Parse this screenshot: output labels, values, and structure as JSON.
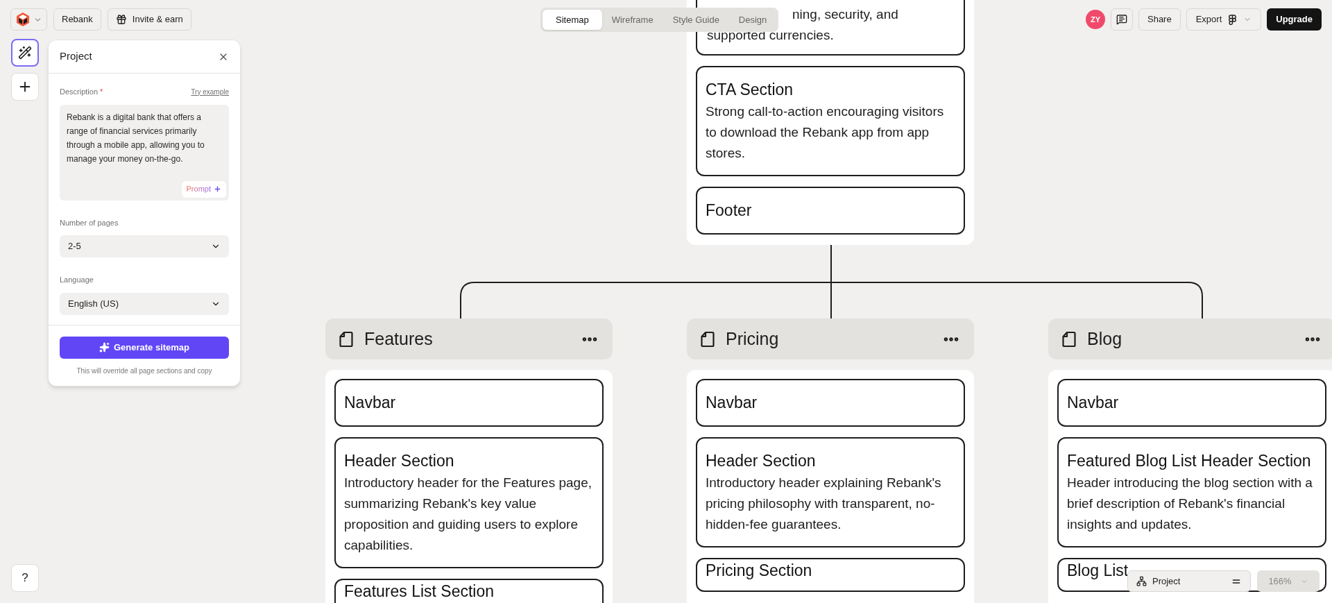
{
  "toolbar": {
    "project_name": "Rebank",
    "invite": "Invite & earn"
  },
  "view_tabs": [
    {
      "label": "Sitemap",
      "selected": true
    },
    {
      "label": "Wireframe",
      "selected": false
    },
    {
      "label": "Style Guide",
      "selected": false
    },
    {
      "label": "Design",
      "selected": false
    }
  ],
  "header_actions": {
    "avatar": "ZY",
    "share": "Share",
    "export": "Export",
    "upgrade": "Upgrade"
  },
  "project_panel": {
    "title": "Project",
    "description_label": "Description",
    "required_mark": "*",
    "try_example": "Try example",
    "description": "Rebank is a digital bank that offers a range of financial services primarily through a mobile app, allowing you to manage your money on-the-go.",
    "prompt_button": "Prompt",
    "pages_label": "Number of pages",
    "pages_value": "2-5",
    "language_label": "Language",
    "language_value": "English (US)",
    "generate_button": "Generate sitemap",
    "note": "This will override all page sections and copy"
  },
  "help_button": "?",
  "sitemap": {
    "home_sections": [
      {
        "lines": [
          "ning, security, and",
          "supported currencies."
        ]
      },
      {
        "title": "CTA Section",
        "description": "Strong call-to-action encouraging visitors to download the Rebank app from app stores."
      },
      {
        "title": "Footer"
      }
    ],
    "pages": [
      {
        "name": "Features",
        "sections": [
          {
            "title": "Navbar"
          },
          {
            "title": "Header Section",
            "description": "Introductory header for the Features page, summarizing Rebank's key value proposition and guiding users to explore capabilities."
          },
          {
            "title": "Features List Section"
          }
        ]
      },
      {
        "name": "Pricing",
        "sections": [
          {
            "title": "Navbar"
          },
          {
            "title": "Header Section",
            "description": "Introductory header explaining Rebank's pricing philosophy with transparent, no-hidden-fee guarantees."
          },
          {
            "title": "Pricing Section"
          }
        ]
      },
      {
        "name": "Blog",
        "sections": [
          {
            "title": "Navbar"
          },
          {
            "title": "Featured Blog List Header Section",
            "description": "Header introducing the blog section with a brief description of Rebank's financial insights and updates."
          },
          {
            "title": "Blog List"
          }
        ]
      }
    ]
  },
  "bottom_bar": {
    "view": "Project",
    "zoom": "166%"
  }
}
